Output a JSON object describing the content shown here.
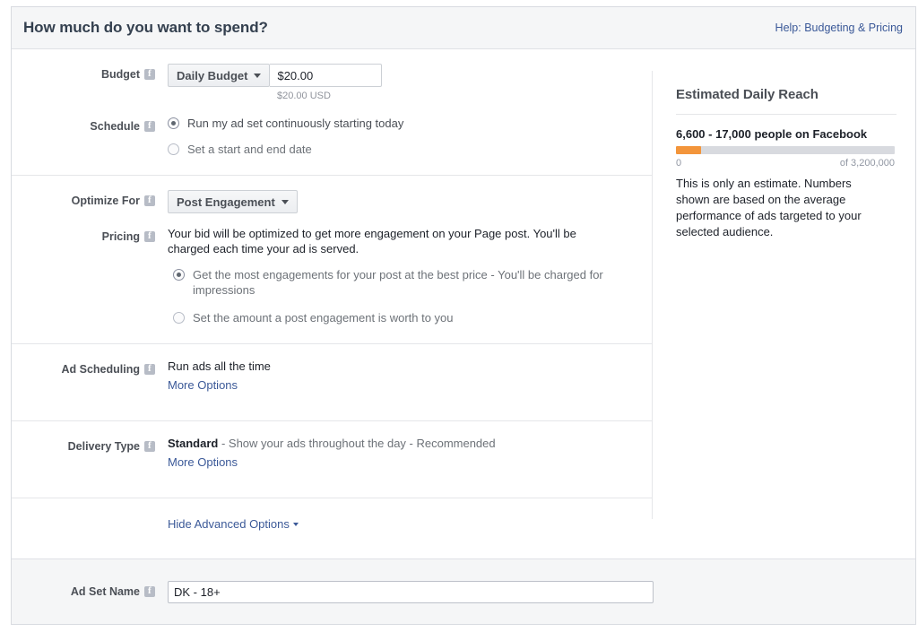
{
  "header": {
    "title": "How much do you want to spend?",
    "help_link": "Help: Budgeting & Pricing"
  },
  "budget": {
    "label": "Budget",
    "type_value": "Daily Budget",
    "amount_value": "$20.00",
    "amount_placeholder": "$0.00",
    "currency_note": "$20.00 USD"
  },
  "schedule": {
    "label": "Schedule",
    "options": [
      {
        "label": "Run my ad set continuously starting today",
        "checked": true
      },
      {
        "label": "Set a start and end date",
        "checked": false
      }
    ]
  },
  "optimize": {
    "label": "Optimize For",
    "value": "Post Engagement"
  },
  "pricing": {
    "label": "Pricing",
    "description": "Your bid will be optimized to get more engagement on your Page post. You'll be charged each time your ad is served.",
    "options": [
      {
        "label": "Get the most engagements for your post at the best price - You'll be charged for impressions",
        "checked": true
      },
      {
        "label": "Set the amount a post engagement is worth to you",
        "checked": false
      }
    ]
  },
  "ad_scheduling": {
    "label": "Ad Scheduling",
    "value": "Run ads all the time",
    "more_options": "More Options"
  },
  "delivery_type": {
    "label": "Delivery Type",
    "value_bold": "Standard",
    "value_rest": " - Show your ads throughout the day - Recommended",
    "more_options": "More Options"
  },
  "advanced": {
    "toggle_label": "Hide Advanced Options"
  },
  "side_panel": {
    "title": "Estimated Daily Reach",
    "reach_headline": "6,600 - 17,000 people on Facebook",
    "meter_percent": 11.5,
    "meter_color": "#f3953b",
    "scale_min": "0",
    "scale_max": "of 3,200,000",
    "note": "This is only an estimate. Numbers shown are based on the average performance of ads targeted to your selected audience."
  },
  "footer": {
    "label": "Ad Set Name",
    "value": "DK - 18+",
    "placeholder": "Enter an ad set name"
  }
}
